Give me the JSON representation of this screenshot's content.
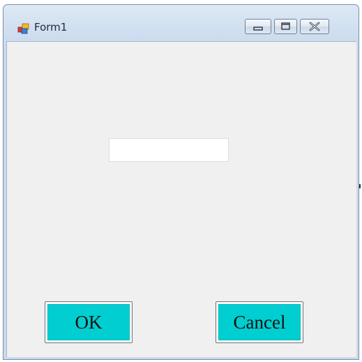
{
  "window": {
    "title": "Form1",
    "icon": "form-app-icon",
    "controls": {
      "minimize_icon": "minimize-icon",
      "maximize_icon": "maximize-icon",
      "close_icon": "close-icon"
    }
  },
  "form": {
    "textbox": {
      "value": "",
      "placeholder": ""
    },
    "ok_label": "OK",
    "cancel_label": "Cancel"
  },
  "colors": {
    "button_face": "#00ced1",
    "client_background": "#f0f0f0",
    "frame": "#d2e1f1"
  }
}
